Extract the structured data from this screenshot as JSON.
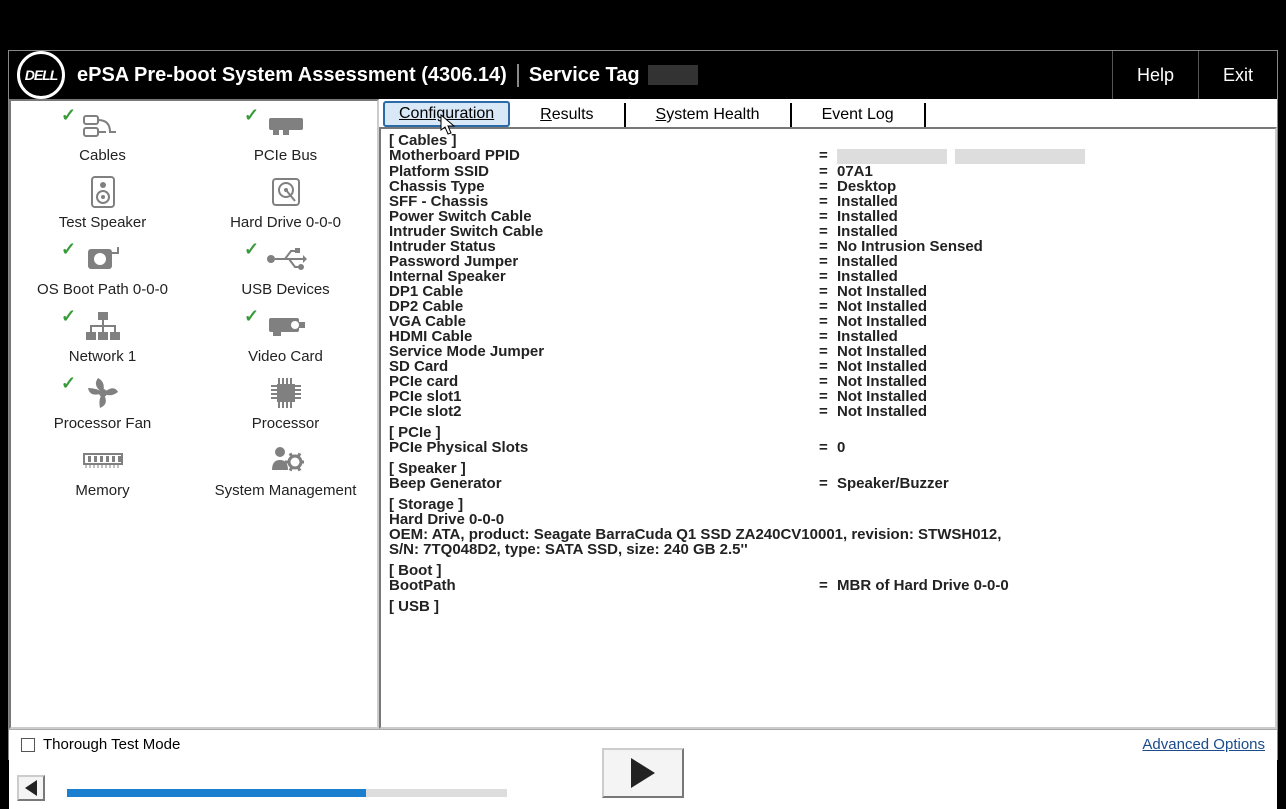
{
  "header": {
    "logo_text": "DELL",
    "title": "ePSA Pre-boot System Assessment (4306.14)",
    "service_tag_label": "Service Tag",
    "help": "Help",
    "exit": "Exit"
  },
  "devices": [
    {
      "label": "Cables",
      "checked": true,
      "icon": "cables"
    },
    {
      "label": "PCIe Bus",
      "checked": true,
      "icon": "pcie"
    },
    {
      "label": "Test Speaker",
      "checked": false,
      "icon": "speaker"
    },
    {
      "label": "Hard Drive 0-0-0",
      "checked": false,
      "icon": "hdd"
    },
    {
      "label": "OS Boot Path 0-0-0",
      "checked": true,
      "icon": "bootpath"
    },
    {
      "label": "USB Devices",
      "checked": true,
      "icon": "usb"
    },
    {
      "label": "Network 1",
      "checked": true,
      "icon": "network"
    },
    {
      "label": "Video Card",
      "checked": true,
      "icon": "video"
    },
    {
      "label": "Processor Fan",
      "checked": true,
      "icon": "fan"
    },
    {
      "label": "Processor",
      "checked": false,
      "icon": "cpu"
    },
    {
      "label": "Memory",
      "checked": false,
      "icon": "memory"
    },
    {
      "label": "System Management",
      "checked": false,
      "icon": "sysmgmt"
    }
  ],
  "tabs": {
    "configuration": "Configuration",
    "results": "Results",
    "systemhealth": "System Health",
    "eventlog": "Event Log",
    "active": "configuration"
  },
  "config": {
    "sections": [
      {
        "title": "[ Cables ]",
        "rows": [
          {
            "k": "Motherboard PPID",
            "v": "__REDACTED__"
          },
          {
            "k": "Platform SSID",
            "v": "07A1"
          },
          {
            "k": "Chassis Type",
            "v": "Desktop"
          },
          {
            "k": "SFF - Chassis",
            "v": "Installed"
          },
          {
            "k": "Power Switch Cable",
            "v": "Installed"
          },
          {
            "k": "Intruder Switch Cable",
            "v": "Installed"
          },
          {
            "k": "Intruder Status",
            "v": "No Intrusion Sensed"
          },
          {
            "k": "Password Jumper",
            "v": "Installed"
          },
          {
            "k": "Internal Speaker",
            "v": "Installed"
          },
          {
            "k": "DP1 Cable",
            "v": "Not Installed"
          },
          {
            "k": "DP2 Cable",
            "v": "Not Installed"
          },
          {
            "k": "VGA Cable",
            "v": "Not Installed"
          },
          {
            "k": "HDMI Cable",
            "v": "Installed"
          },
          {
            "k": "Service Mode Jumper",
            "v": "Not Installed"
          },
          {
            "k": "SD Card",
            "v": "Not Installed"
          },
          {
            "k": "PCIe card",
            "v": "Not Installed"
          },
          {
            "k": "PCIe slot1",
            "v": "Not Installed"
          },
          {
            "k": "PCIe slot2",
            "v": "Not Installed"
          }
        ]
      },
      {
        "title": "[ PCIe ]",
        "rows": [
          {
            "k": "PCIe Physical Slots",
            "v": "0"
          }
        ]
      },
      {
        "title": "[ Speaker ]",
        "rows": [
          {
            "k": "Beep Generator",
            "v": "Speaker/Buzzer"
          }
        ]
      },
      {
        "title": "[ Storage ]",
        "plain": [
          "Hard Drive 0-0-0",
          "        OEM: ATA, product: Seagate BarraCuda Q1 SSD ZA240CV10001, revision: STWSH012,",
          "        S/N: 7TQ048D2, type: SATA SSD, size: 240 GB 2.5''"
        ]
      },
      {
        "title": "[ Boot ]",
        "rows": [
          {
            "k": "BootPath",
            "v": "MBR of Hard Drive 0-0-0"
          }
        ]
      },
      {
        "title": "[ USB ]",
        "rows": []
      }
    ]
  },
  "footer": {
    "thorough_label": "Thorough Test Mode",
    "advanced_options": "Advanced Options",
    "progress_pct": 68
  }
}
